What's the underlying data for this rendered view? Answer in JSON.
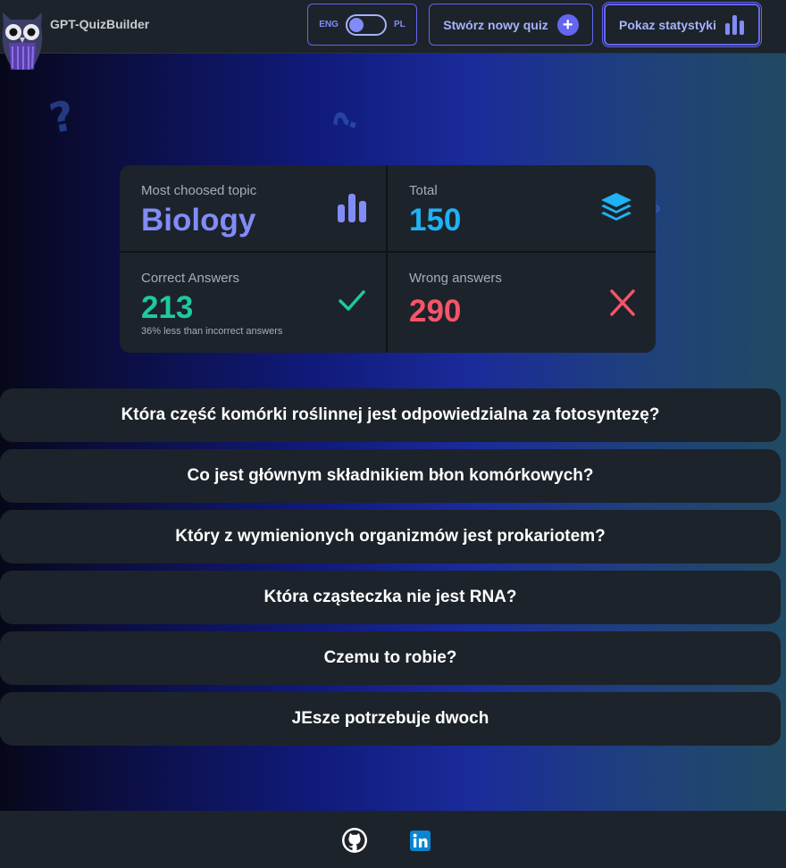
{
  "header": {
    "app_title": "GPT-QuizBuilder",
    "lang_left": "ENG",
    "lang_right": "PL",
    "new_quiz_label": "Stwórz nowy quiz",
    "stats_label": "Pokaz statystyki"
  },
  "stats": {
    "topic": {
      "title": "Most choosed topic",
      "value": "Biology",
      "icon": "bar-chart-icon",
      "color": "#818cf8"
    },
    "total": {
      "title": "Total",
      "value": "150",
      "icon": "layers-icon",
      "color": "#1fb2f5"
    },
    "correct": {
      "title": "Correct Answers",
      "value": "213",
      "desc": "36% less than incorrect answers",
      "icon": "checkmark-icon",
      "color": "#1ccaa0"
    },
    "wrong": {
      "title": "Wrong answers",
      "value": "290",
      "icon": "x-icon",
      "color": "#f6546a"
    }
  },
  "questions": [
    "Która część komórki roślinnej jest odpowiedzialna za fotosyntezę?",
    "Co jest głównym składnikiem błon komórkowych?",
    "Który z wymienionych organizmów jest prokariotem?",
    "Która cząsteczka nie jest RNA?",
    "Czemu to robie?",
    "JEsze potrzebuje dwoch"
  ],
  "footer": {
    "icons": [
      "github-icon",
      "linkedin-icon"
    ]
  }
}
